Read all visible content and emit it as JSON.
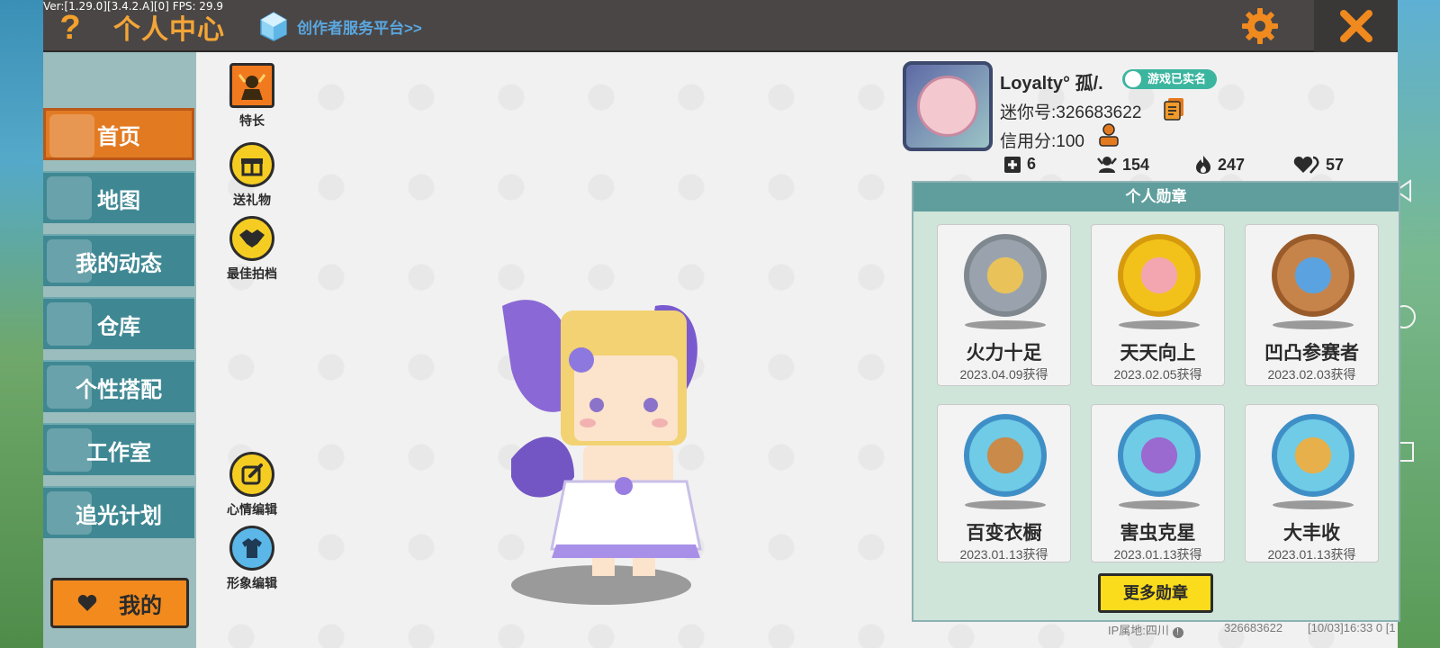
{
  "header": {
    "version": "Ver:[1.29.0][3.4.2.A][0] FPS: 29.9",
    "title": "个人中心",
    "creator_link": "创作者服务平台>>"
  },
  "sidebar": {
    "items": [
      {
        "label": "首页",
        "active": true
      },
      {
        "label": "地图"
      },
      {
        "label": "我的动态"
      },
      {
        "label": "仓库"
      },
      {
        "label": "个性搭配"
      },
      {
        "label": "工作室"
      },
      {
        "label": "追光计划"
      }
    ],
    "me_label": "我的"
  },
  "actions": {
    "talent": "特长",
    "gift": "送礼物",
    "partner": "最佳拍档",
    "mood": "心情编辑",
    "appearance": "形象编辑"
  },
  "profile": {
    "name": "Loyalty°  孤/.",
    "verified": "游戏已实名",
    "mini_id": "迷你号:326683622",
    "credit": "信用分:100"
  },
  "stats": {
    "posts": "6",
    "followers": "154",
    "hot": "247",
    "likes": "57"
  },
  "medals": {
    "title": "个人勋章",
    "items": [
      {
        "name": "火力十足",
        "date": "2023.04.09获得",
        "color": "#c8c8c8"
      },
      {
        "name": "天天向上",
        "date": "2023.02.05获得",
        "color": "#f2c21a"
      },
      {
        "name": "凹凸参赛者",
        "date": "2023.02.03获得",
        "color": "#c7844a"
      },
      {
        "name": "百变衣橱",
        "date": "2023.01.13获得",
        "color": "#6fcbe6"
      },
      {
        "name": "害虫克星",
        "date": "2023.01.13获得",
        "color": "#6fcbe6"
      },
      {
        "name": "大丰收",
        "date": "2023.01.13获得",
        "color": "#6fcbe6"
      }
    ],
    "more_label": "更多勋章"
  },
  "footer": {
    "ip": "IP属地:四川",
    "uid": "326683622",
    "time": "[10/03]16:33 0 [1"
  }
}
